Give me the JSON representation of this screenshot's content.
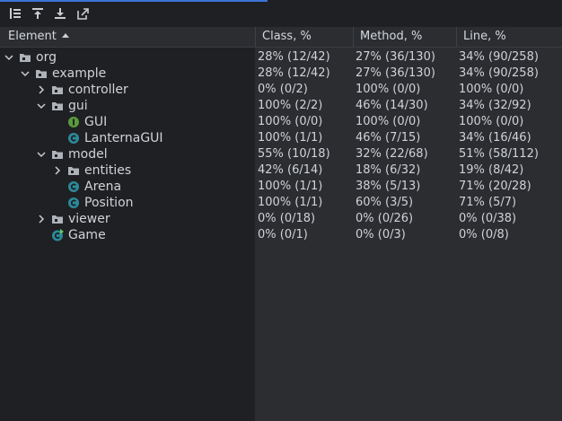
{
  "header": {
    "element": "Element",
    "class": "Class, %",
    "method": "Method, %",
    "line": "Line, %"
  },
  "rows": [
    {
      "name": "org",
      "icon": "package-folder-icon",
      "expanded": true,
      "cls": "28% (12/42)",
      "method": "27% (36/130)",
      "line": "34% (90/258)"
    },
    {
      "name": "example",
      "icon": "package-folder-icon",
      "expanded": true,
      "cls": "28% (12/42)",
      "method": "27% (36/130)",
      "line": "34% (90/258)"
    },
    {
      "name": "controller",
      "icon": "package-folder-icon",
      "expanded": false,
      "cls": "0% (0/2)",
      "method": "100% (0/0)",
      "line": "100% (0/0)"
    },
    {
      "name": "gui",
      "icon": "package-folder-icon",
      "expanded": true,
      "cls": "100% (2/2)",
      "method": "46% (14/30)",
      "line": "34% (32/92)"
    },
    {
      "name": "GUI",
      "icon": "interface-icon",
      "cls": "100% (0/0)",
      "method": "100% (0/0)",
      "line": "100% (0/0)"
    },
    {
      "name": "LanternaGUI",
      "icon": "class-icon",
      "cls": "100% (1/1)",
      "method": "46% (7/15)",
      "line": "34% (16/46)"
    },
    {
      "name": "model",
      "icon": "package-folder-icon",
      "expanded": true,
      "cls": "55% (10/18)",
      "method": "32% (22/68)",
      "line": "51% (58/112)"
    },
    {
      "name": "entities",
      "icon": "package-folder-icon",
      "expanded": false,
      "cls": "42% (6/14)",
      "method": "18% (6/32)",
      "line": "19% (8/42)"
    },
    {
      "name": "Arena",
      "icon": "class-icon",
      "cls": "100% (1/1)",
      "method": "38% (5/13)",
      "line": "71% (20/28)"
    },
    {
      "name": "Position",
      "icon": "class-icon",
      "cls": "100% (1/1)",
      "method": "60% (3/5)",
      "line": "71% (5/7)"
    },
    {
      "name": "viewer",
      "icon": "package-folder-icon",
      "expanded": false,
      "cls": "0% (0/18)",
      "method": "0% (0/26)",
      "line": "0% (0/38)"
    },
    {
      "name": "Game",
      "icon": "main-class-icon",
      "cls": "0% (0/1)",
      "method": "0% (0/3)",
      "line": "0% (0/8)"
    }
  ],
  "colors": {
    "accent": "#3c74d6",
    "class_icon": "#2b8a9a",
    "interface_icon": "#5a9a3a",
    "main_badge": "#5fd068"
  }
}
